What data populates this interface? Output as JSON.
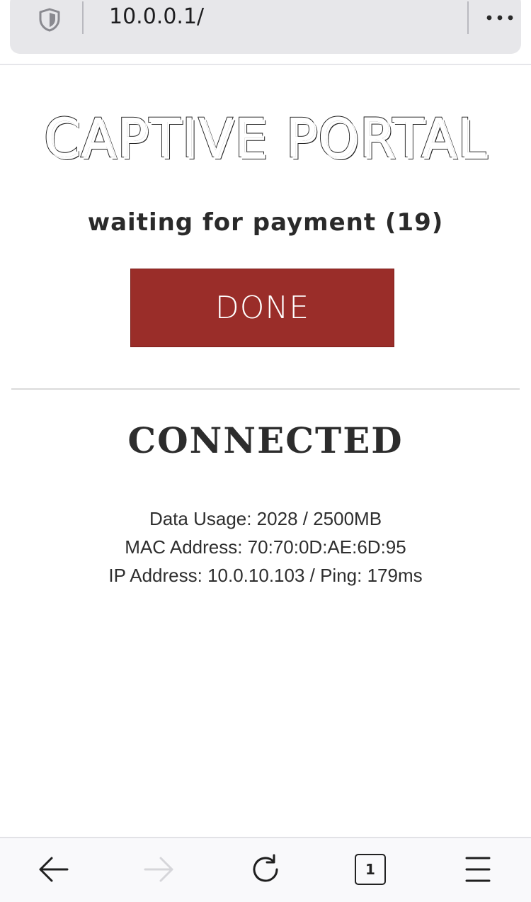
{
  "browser": {
    "url": "10.0.0.1/",
    "shield_icon": "shield-icon",
    "more_icon": "more-dots-icon",
    "tab_count": "1"
  },
  "page": {
    "title": "CAPTIVE PORTAL",
    "status": "waiting for payment (19)",
    "done_label": "DONE",
    "connected_label": "CONNECTED",
    "info": {
      "data_usage": "Data Usage: 2028 / 2500MB",
      "mac_address": "MAC Address: 70:70:0D:AE:6D:95",
      "ip_ping": "IP Address: 10.0.10.103 / Ping: 179ms"
    }
  },
  "colors": {
    "done_button_bg": "#9a2d29",
    "url_bar_bg": "#e7e7ea",
    "text_dark": "#2a2a2a"
  },
  "toolbar": {
    "back_icon": "arrow-left-icon",
    "forward_icon": "arrow-right-icon",
    "reload_icon": "reload-icon",
    "tabs_icon": "tabs-icon",
    "menu_icon": "hamburger-menu-icon"
  }
}
